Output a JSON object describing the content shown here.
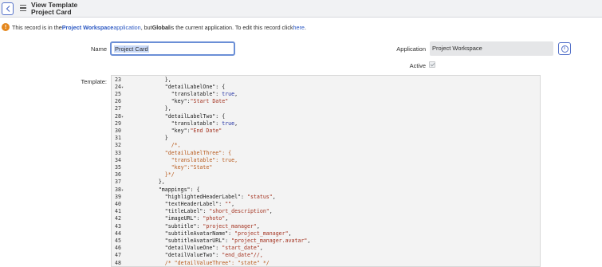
{
  "header": {
    "title": "View Template",
    "subtitle": "Project Card"
  },
  "notice": {
    "prefix": "This record is in the ",
    "app_link": "Project Workspace",
    "app_word": " application",
    "middle": ", but ",
    "global": "Global",
    "suffix": " is the current application. To edit this record click ",
    "here_link": "here",
    "end": "."
  },
  "form": {
    "name_label": "Name",
    "name_value": "Project Card",
    "application_label": "Application",
    "application_value": "Project Workspace",
    "active_label": "Active",
    "active_checked": true,
    "template_label": "Template:"
  },
  "editor": {
    "lines": [
      {
        "n": "23",
        "fold": false,
        "segs": [
          {
            "t": "        },",
            "c": ""
          }
        ]
      },
      {
        "n": "24",
        "fold": true,
        "segs": [
          {
            "t": "        \"detailLabelOne\": {",
            "c": ""
          }
        ]
      },
      {
        "n": "25",
        "fold": false,
        "segs": [
          {
            "t": "          \"translatable\": ",
            "c": ""
          },
          {
            "t": "true",
            "c": "kw"
          },
          {
            "t": ",",
            "c": ""
          }
        ]
      },
      {
        "n": "26",
        "fold": false,
        "segs": [
          {
            "t": "          \"key\":",
            "c": ""
          },
          {
            "t": "\"Start Date\"",
            "c": "str"
          }
        ]
      },
      {
        "n": "27",
        "fold": false,
        "segs": [
          {
            "t": "        },",
            "c": ""
          }
        ]
      },
      {
        "n": "28",
        "fold": true,
        "segs": [
          {
            "t": "        \"detailLabelTwo\": {",
            "c": ""
          }
        ]
      },
      {
        "n": "29",
        "fold": false,
        "segs": [
          {
            "t": "          \"translatable\": ",
            "c": ""
          },
          {
            "t": "true",
            "c": "kw"
          },
          {
            "t": ",",
            "c": ""
          }
        ]
      },
      {
        "n": "30",
        "fold": false,
        "segs": [
          {
            "t": "          \"key\":",
            "c": ""
          },
          {
            "t": "\"End Date\"",
            "c": "str"
          }
        ]
      },
      {
        "n": "31",
        "fold": false,
        "segs": [
          {
            "t": "        }",
            "c": ""
          }
        ]
      },
      {
        "n": "32",
        "fold": false,
        "segs": [
          {
            "t": "          /*,",
            "c": "cm"
          }
        ]
      },
      {
        "n": "33",
        "fold": false,
        "segs": [
          {
            "t": "        \"detailLabelThree\": {",
            "c": "cm"
          }
        ]
      },
      {
        "n": "34",
        "fold": false,
        "segs": [
          {
            "t": "          \"translatable\": true,",
            "c": "cm"
          }
        ]
      },
      {
        "n": "35",
        "fold": false,
        "segs": [
          {
            "t": "          \"key\":\"State\"",
            "c": "cm"
          }
        ]
      },
      {
        "n": "36",
        "fold": false,
        "segs": [
          {
            "t": "        }*/",
            "c": "cm"
          }
        ]
      },
      {
        "n": "37",
        "fold": false,
        "segs": [
          {
            "t": "      },",
            "c": ""
          }
        ]
      },
      {
        "n": "38",
        "fold": true,
        "segs": [
          {
            "t": "      \"mappings\": {",
            "c": ""
          }
        ]
      },
      {
        "n": "39",
        "fold": false,
        "segs": [
          {
            "t": "        \"highlightedHeaderLabel\": ",
            "c": ""
          },
          {
            "t": "\"status\"",
            "c": "str"
          },
          {
            "t": ",",
            "c": ""
          }
        ]
      },
      {
        "n": "40",
        "fold": false,
        "segs": [
          {
            "t": "        \"textHeaderLabel\": ",
            "c": ""
          },
          {
            "t": "\"\"",
            "c": "str"
          },
          {
            "t": ",",
            "c": ""
          }
        ]
      },
      {
        "n": "41",
        "fold": false,
        "segs": [
          {
            "t": "        \"titleLabel\": ",
            "c": ""
          },
          {
            "t": "\"short_description\"",
            "c": "str"
          },
          {
            "t": ",",
            "c": ""
          }
        ]
      },
      {
        "n": "42",
        "fold": false,
        "segs": [
          {
            "t": "        \"imageURL\": ",
            "c": ""
          },
          {
            "t": "\"photo\"",
            "c": "str"
          },
          {
            "t": ",",
            "c": ""
          }
        ]
      },
      {
        "n": "43",
        "fold": false,
        "segs": [
          {
            "t": "        \"subtitle\": ",
            "c": ""
          },
          {
            "t": "\"project_manager\"",
            "c": "str"
          },
          {
            "t": ",",
            "c": ""
          }
        ]
      },
      {
        "n": "44",
        "fold": false,
        "segs": [
          {
            "t": "        \"subtitleAvatarName\": ",
            "c": ""
          },
          {
            "t": "\"project_manager\"",
            "c": "str"
          },
          {
            "t": ",",
            "c": ""
          }
        ]
      },
      {
        "n": "45",
        "fold": false,
        "segs": [
          {
            "t": "        \"subtitleAvatarURL\": ",
            "c": ""
          },
          {
            "t": "\"project_manager.avatar\"",
            "c": "str"
          },
          {
            "t": ",",
            "c": ""
          }
        ]
      },
      {
        "n": "46",
        "fold": false,
        "segs": [
          {
            "t": "        \"detailValueOne\": ",
            "c": ""
          },
          {
            "t": "\"start_date\"",
            "c": "str"
          },
          {
            "t": ",",
            "c": ""
          }
        ]
      },
      {
        "n": "47",
        "fold": false,
        "segs": [
          {
            "t": "        \"detailValueTwo\": ",
            "c": ""
          },
          {
            "t": "\"end_date\"//,",
            "c": "str"
          }
        ]
      },
      {
        "n": "48",
        "fold": false,
        "segs": [
          {
            "t": "        /* \"detailValueThree\": \"state\" */",
            "c": "cm"
          }
        ]
      },
      {
        "n": "49",
        "fold": false,
        "segs": [
          {
            "t": "      },",
            "c": ""
          }
        ]
      }
    ]
  },
  "icons": {
    "back": "chevron-left-icon",
    "menu": "hamburger-menu-icon",
    "warning": "warning-icon",
    "info": "info-icon",
    "fold": "fold-arrow-icon"
  },
  "colors": {
    "link": "#2d59c3",
    "warning": "#e4871d",
    "string": "#a3311e",
    "keyword": "#1f2ea3",
    "comment": "#b85a1c"
  }
}
